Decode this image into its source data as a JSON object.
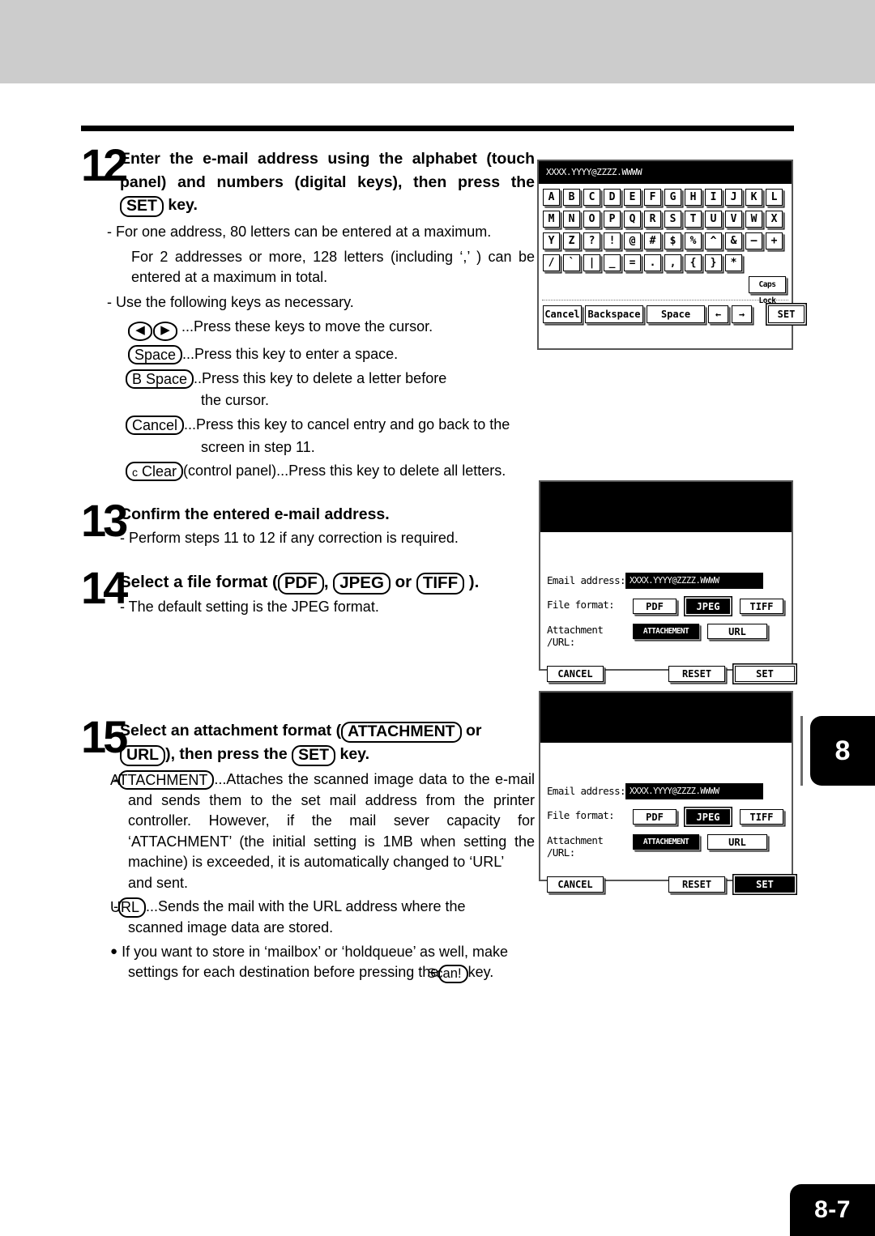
{
  "page": {
    "chapter_tab": "8",
    "page_number": "8-7"
  },
  "steps": [
    {
      "num": "12",
      "heading_part1": "Enter the e-mail address using the alphabet (touch panel) and numbers (digital keys), then press the",
      "heading_key": "SET",
      "heading_part2": "key.",
      "lines": {
        "l1": "- For one address, 80 letters can be entered at a maximum.",
        "l2": "For 2 addresses or more, 128 letters (including ‘,’ ) can be entered at a maximum in total.",
        "l3": "-  Use the following keys as necessary.",
        "cursor_desc": "...Press these keys to move the cursor.",
        "space_key": "Space",
        "space_desc": "...Press this key to enter a space.",
        "bspace_key": "B Space",
        "bspace_desc": "..Press this key to delete a letter before",
        "bspace_desc2": "the cursor.",
        "cancel_key": "Cancel",
        "cancel_desc": "...Press this key to cancel entry and go back to the",
        "cancel_desc2": "screen in step 11.",
        "clear_key_c": "c",
        "clear_key": "Clear",
        "clear_desc": "(control panel)...Press this key to delete all letters."
      }
    },
    {
      "num": "13",
      "heading": "Confirm the entered e-mail address.",
      "sub": "-  Perform steps 11 to 12 if any correction is required."
    },
    {
      "num": "14",
      "heading_part1": "Select a file format (",
      "key1": "PDF",
      "sep1": ", ",
      "key2": "JPEG",
      "sep2": " or ",
      "key3": "TIFF",
      "heading_part2": " ).",
      "sub": "-  The default setting is the JPEG format."
    },
    {
      "num": "15",
      "heading_part1": "Select an attachment format (",
      "key1": "ATTACHMENT",
      "heading_part2": " or",
      "key2": "URL",
      "heading_part3": "), then press the",
      "key3": "SET",
      "heading_part4": "key.",
      "attach_key": "ATTACHMENT",
      "attach_desc": "...Attaches the scanned image data to the e-mail and sends them to the set mail address from the printer controller. However, if the mail sever capacity for ‘ATTACHMENT’ (the initial setting is 1MB when setting the machine) is exceeded, it is automatically changed to ‘URL’",
      "attach_desc2": "and sent.",
      "url_key": "URL",
      "url_desc": "...Sends the mail with the URL address where the",
      "url_desc2": "scanned image data are stored.",
      "note_part1": "If you want to store in ‘mailbox’ or ‘holdqueue’ as well, make settings for each destination before pressing the",
      "note_key": "Scan!",
      "note_part2": "key."
    }
  ],
  "keyboard_screen": {
    "address_display": "XXXX.YYYY@ZZZZ.WWWW",
    "row1": [
      "A",
      "B",
      "C",
      "D",
      "E",
      "F",
      "G",
      "H",
      "I",
      "J",
      "K",
      "L"
    ],
    "row2": [
      "M",
      "N",
      "O",
      "P",
      "Q",
      "R",
      "S",
      "T",
      "U",
      "V",
      "W",
      "X"
    ],
    "row3": [
      "Y",
      "Z",
      "?",
      "!",
      "@",
      "#",
      "$",
      "%",
      "^",
      "&",
      "—",
      "+"
    ],
    "row4": [
      "/",
      "`",
      "|",
      "_",
      "=",
      ".",
      ",",
      "{",
      "}",
      "*"
    ],
    "caps_lock": "Caps Lock",
    "cancel": "Cancel",
    "backspace": "Backspace",
    "space": "Space",
    "arrow_left": "←",
    "arrow_right": "→",
    "set": "SET"
  },
  "settings_screen": {
    "email_label": "Email address:",
    "email_value": "XXXX.YYYY@ZZZZ.WWWW",
    "file_format_label": "File format:",
    "file_formats": [
      "PDF",
      "JPEG",
      "TIFF"
    ],
    "file_format_selected": "JPEG",
    "attachment_label_line1": "Attachment",
    "attachment_label_line2": "/URL:",
    "attachment_options": [
      "ATTACHEMENT",
      "URL"
    ],
    "attachment_selected": "ATTACHEMENT",
    "cancel": "CANCEL",
    "reset": "RESET",
    "set": "SET",
    "set_selected_screen2": true
  }
}
